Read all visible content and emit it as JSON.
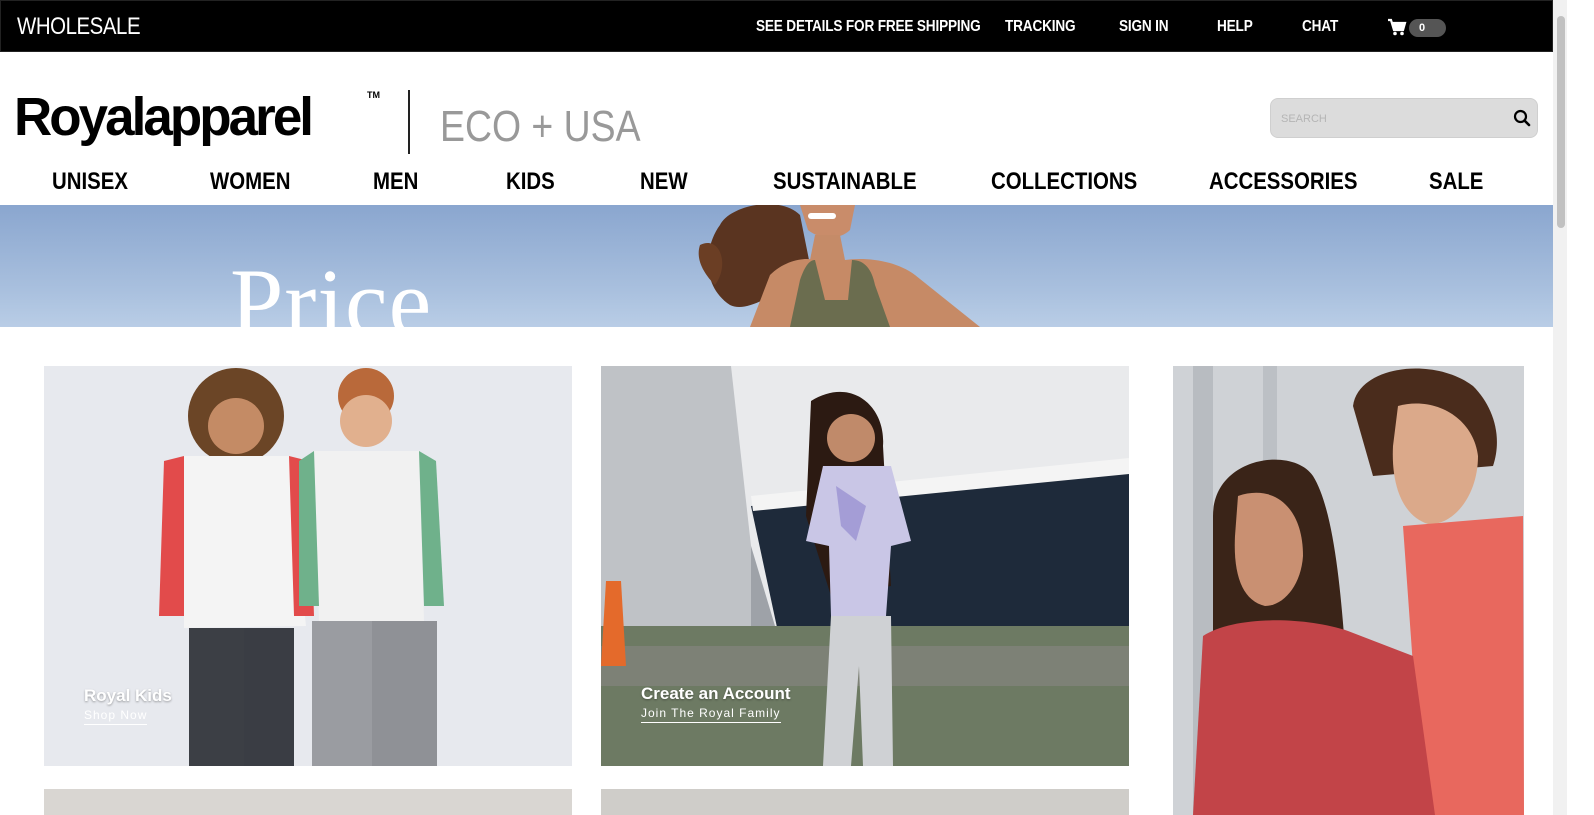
{
  "topbar": {
    "wholesale": "WHOLESALE",
    "links": [
      "SEE DETAILS FOR FREE SHIPPING",
      "TRACKING",
      "SIGN IN",
      "HELP",
      "CHAT"
    ],
    "cart_count": "0"
  },
  "header": {
    "logo": "Royalapparel",
    "logo_tm": "TM",
    "eco": "ECO + USA",
    "search_placeholder": "SEARCH"
  },
  "nav": [
    "UNISEX",
    "WOMEN",
    "MEN",
    "KIDS",
    "NEW",
    "SUSTAINABLE",
    "COLLECTIONS",
    "ACCESSORIES",
    "SALE"
  ],
  "banner": {
    "text": "Price"
  },
  "tiles": [
    {
      "title": "Royal Kids",
      "subtitle": "Shop Now"
    },
    {
      "title": "Create an Account",
      "subtitle": "Join The Royal Family"
    }
  ],
  "colors": {
    "topbar": "#000000",
    "banner_sky": "#8aa6cf",
    "eco_text": "#999999"
  }
}
